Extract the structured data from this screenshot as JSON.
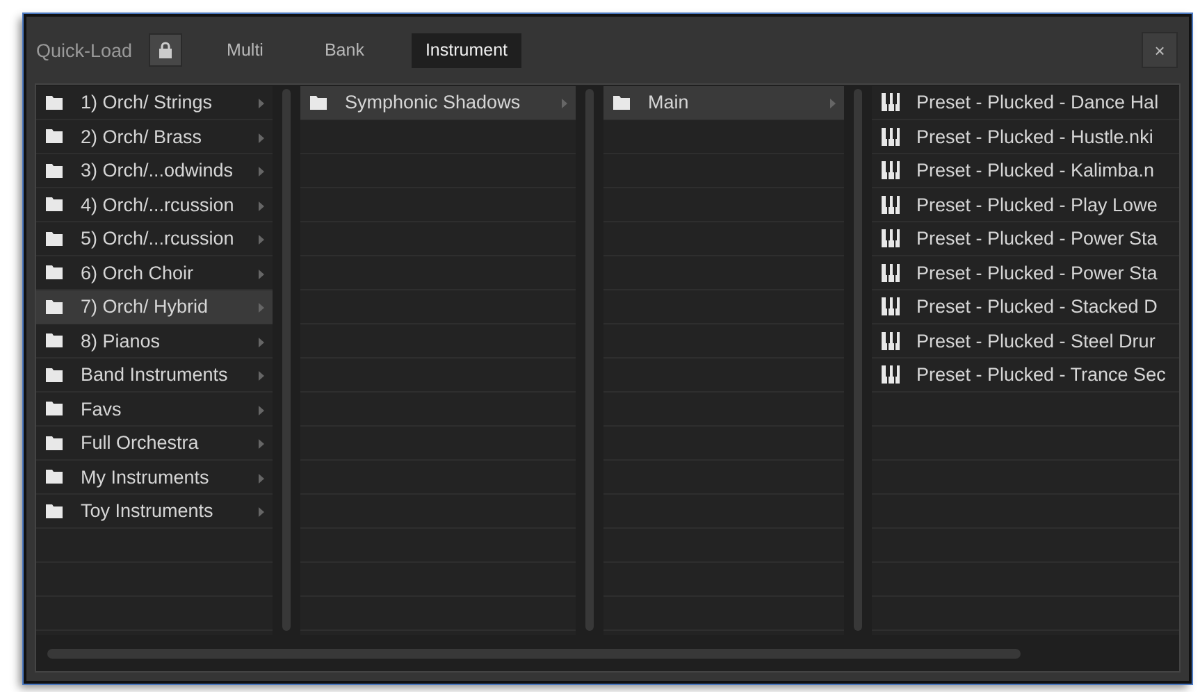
{
  "header": {
    "title": "Quick-Load",
    "lock": {
      "on": false
    },
    "tabs": [
      {
        "label": "Multi",
        "selected": false
      },
      {
        "label": "Bank",
        "selected": false
      },
      {
        "label": "Instrument",
        "selected": true
      }
    ],
    "close": "×"
  },
  "columns": [
    {
      "items": [
        {
          "kind": "folder",
          "label": "1) Orch/ Strings",
          "selected": false
        },
        {
          "kind": "folder",
          "label": "2) Orch/ Brass",
          "selected": false
        },
        {
          "kind": "folder",
          "label": "3) Orch/...odwinds",
          "selected": false
        },
        {
          "kind": "folder",
          "label": "4) Orch/...rcussion",
          "selected": false
        },
        {
          "kind": "folder",
          "label": "5) Orch/...rcussion",
          "selected": false
        },
        {
          "kind": "folder",
          "label": "6) Orch Choir",
          "selected": false
        },
        {
          "kind": "folder",
          "label": "7) Orch/ Hybrid",
          "selected": true
        },
        {
          "kind": "folder",
          "label": "8) Pianos",
          "selected": false
        },
        {
          "kind": "folder",
          "label": "Band Instruments",
          "selected": false
        },
        {
          "kind": "folder",
          "label": "Favs",
          "selected": false
        },
        {
          "kind": "folder",
          "label": "Full Orchestra",
          "selected": false
        },
        {
          "kind": "folder",
          "label": "My Instruments",
          "selected": false
        },
        {
          "kind": "folder",
          "label": "Toy Instruments",
          "selected": false
        }
      ]
    },
    {
      "items": [
        {
          "kind": "folder",
          "label": "Symphonic Shadows",
          "selected": true
        }
      ]
    },
    {
      "items": [
        {
          "kind": "folder",
          "label": "Main",
          "selected": true
        }
      ]
    },
    {
      "items": [
        {
          "kind": "instrument",
          "label": "Preset - Plucked - Dance Hal",
          "selected": false
        },
        {
          "kind": "instrument",
          "label": "Preset - Plucked - Hustle.nki",
          "selected": false
        },
        {
          "kind": "instrument",
          "label": "Preset - Plucked - Kalimba.n",
          "selected": false
        },
        {
          "kind": "instrument",
          "label": "Preset - Plucked - Play Lowe",
          "selected": false
        },
        {
          "kind": "instrument",
          "label": "Preset - Plucked - Power Sta",
          "selected": false
        },
        {
          "kind": "instrument",
          "label": "Preset - Plucked - Power Sta",
          "selected": false
        },
        {
          "kind": "instrument",
          "label": "Preset - Plucked - Stacked D",
          "selected": false
        },
        {
          "kind": "instrument",
          "label": "Preset - Plucked - Steel Drur",
          "selected": false
        },
        {
          "kind": "instrument",
          "label": "Preset - Plucked - Trance Sec",
          "selected": false
        }
      ]
    }
  ]
}
